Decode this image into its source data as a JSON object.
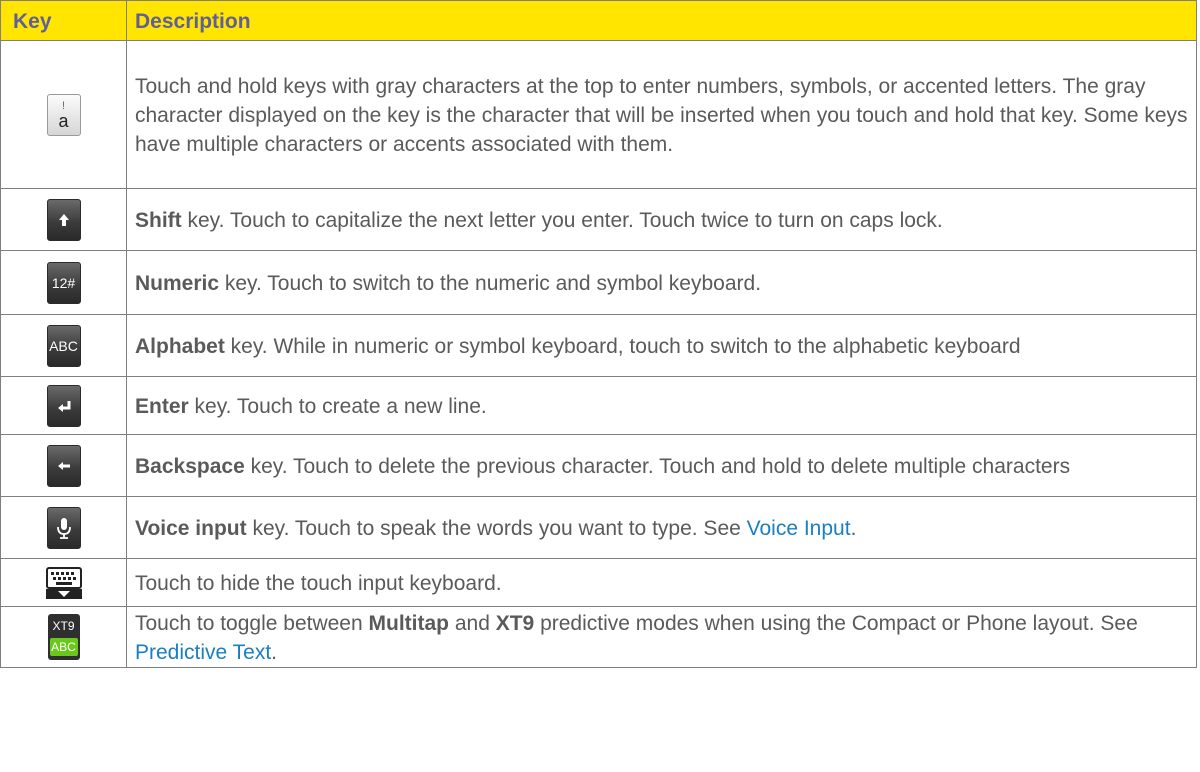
{
  "header": {
    "key": "Key",
    "description": "Description"
  },
  "rows": [
    {
      "icon": "accented-letter-key-icon",
      "key_top": "!",
      "key_main": "a",
      "text": "Touch and hold keys with gray characters at the top to enter numbers, symbols, or accented letters. The gray character displayed on the key is the character that will be inserted when you touch and hold that key. Some keys have multiple characters or accents associated with them."
    },
    {
      "icon": "shift-key-icon",
      "bold": "Shift",
      "text": " key. Touch to capitalize the next letter you enter. Touch twice to turn on caps lock."
    },
    {
      "icon": "numeric-key-icon",
      "key_label": "12#",
      "bold": "Numeric",
      "text": " key. Touch to switch to the numeric and symbol keyboard."
    },
    {
      "icon": "alphabet-key-icon",
      "key_label": "ABC",
      "bold": "Alphabet",
      "text": " key. While in numeric or symbol keyboard, touch to switch to the alphabetic keyboard"
    },
    {
      "icon": "enter-key-icon",
      "bold": "Enter",
      "text": " key. Touch to create a new line."
    },
    {
      "icon": "backspace-key-icon",
      "bold": "Backspace",
      "text": " key. Touch to delete the previous character. Touch and hold to delete multiple characters"
    },
    {
      "icon": "microphone-key-icon",
      "bold": "Voice input",
      "text": " key. Touch to speak the words you want to type. See ",
      "link": "Voice Input",
      "after": "."
    },
    {
      "icon": "hide-keyboard-icon",
      "text": "Touch to hide the touch input keyboard."
    },
    {
      "icon": "xt9-toggle-key-icon",
      "key_top": "XT9",
      "key_bottom": "ABC",
      "pre": "Touch to toggle between ",
      "bold1": "Multitap",
      "mid": " and ",
      "bold2": "XT9",
      "post": " predictive modes when using the Compact or Phone layout. See ",
      "link": "Predictive Text",
      "after": "."
    }
  ]
}
